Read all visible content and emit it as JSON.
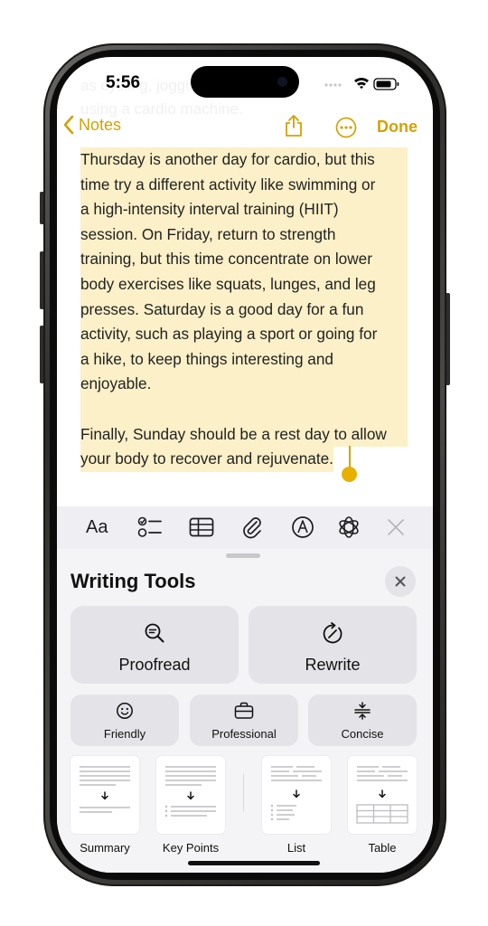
{
  "status": {
    "time": "5:56"
  },
  "nav": {
    "back_label": "Notes",
    "done_label": "Done"
  },
  "note": {
    "faded_top": [
      "as cycling, jogging, or",
      "using a cardio machine."
    ],
    "lines": [
      "Thursday is another day for cardio, but this",
      "time try a different activity like swimming or",
      "a high-intensity interval training (HIIT)",
      "session. On Friday, return to strength",
      "training, but this time concentrate on lower",
      "body exercises like squats, lunges, and leg",
      "presses. Saturday is a good day for a fun",
      "activity, such as playing a sport or going for",
      "a hike, to keep things interesting and",
      "enjoyable.",
      "",
      "Finally, Sunday should be a rest day to allow",
      "your body to recover and rejuvenate."
    ]
  },
  "toolbar": {
    "format_label": "Aa"
  },
  "writing_tools": {
    "title": "Writing Tools",
    "proofread_label": "Proofread",
    "rewrite_label": "Rewrite",
    "friendly_label": "Friendly",
    "professional_label": "Professional",
    "concise_label": "Concise",
    "summary_label": "Summary",
    "key_points_label": "Key Points",
    "list_label": "List",
    "table_label": "Table"
  },
  "colors": {
    "accent": "#d6a100",
    "highlight": "#fcf0c8",
    "sheet_bg": "#f4f4f6",
    "button_bg": "#e3e3e8"
  },
  "icons": [
    "chevron-left-icon",
    "share-icon",
    "more-icon",
    "checklist-icon",
    "table-icon",
    "paperclip-icon",
    "markup-icon",
    "writing-tools-icon",
    "close-icon",
    "proofread-icon",
    "rewrite-icon",
    "smiley-icon",
    "briefcase-icon",
    "concise-icon",
    "down-arrow-icon"
  ]
}
